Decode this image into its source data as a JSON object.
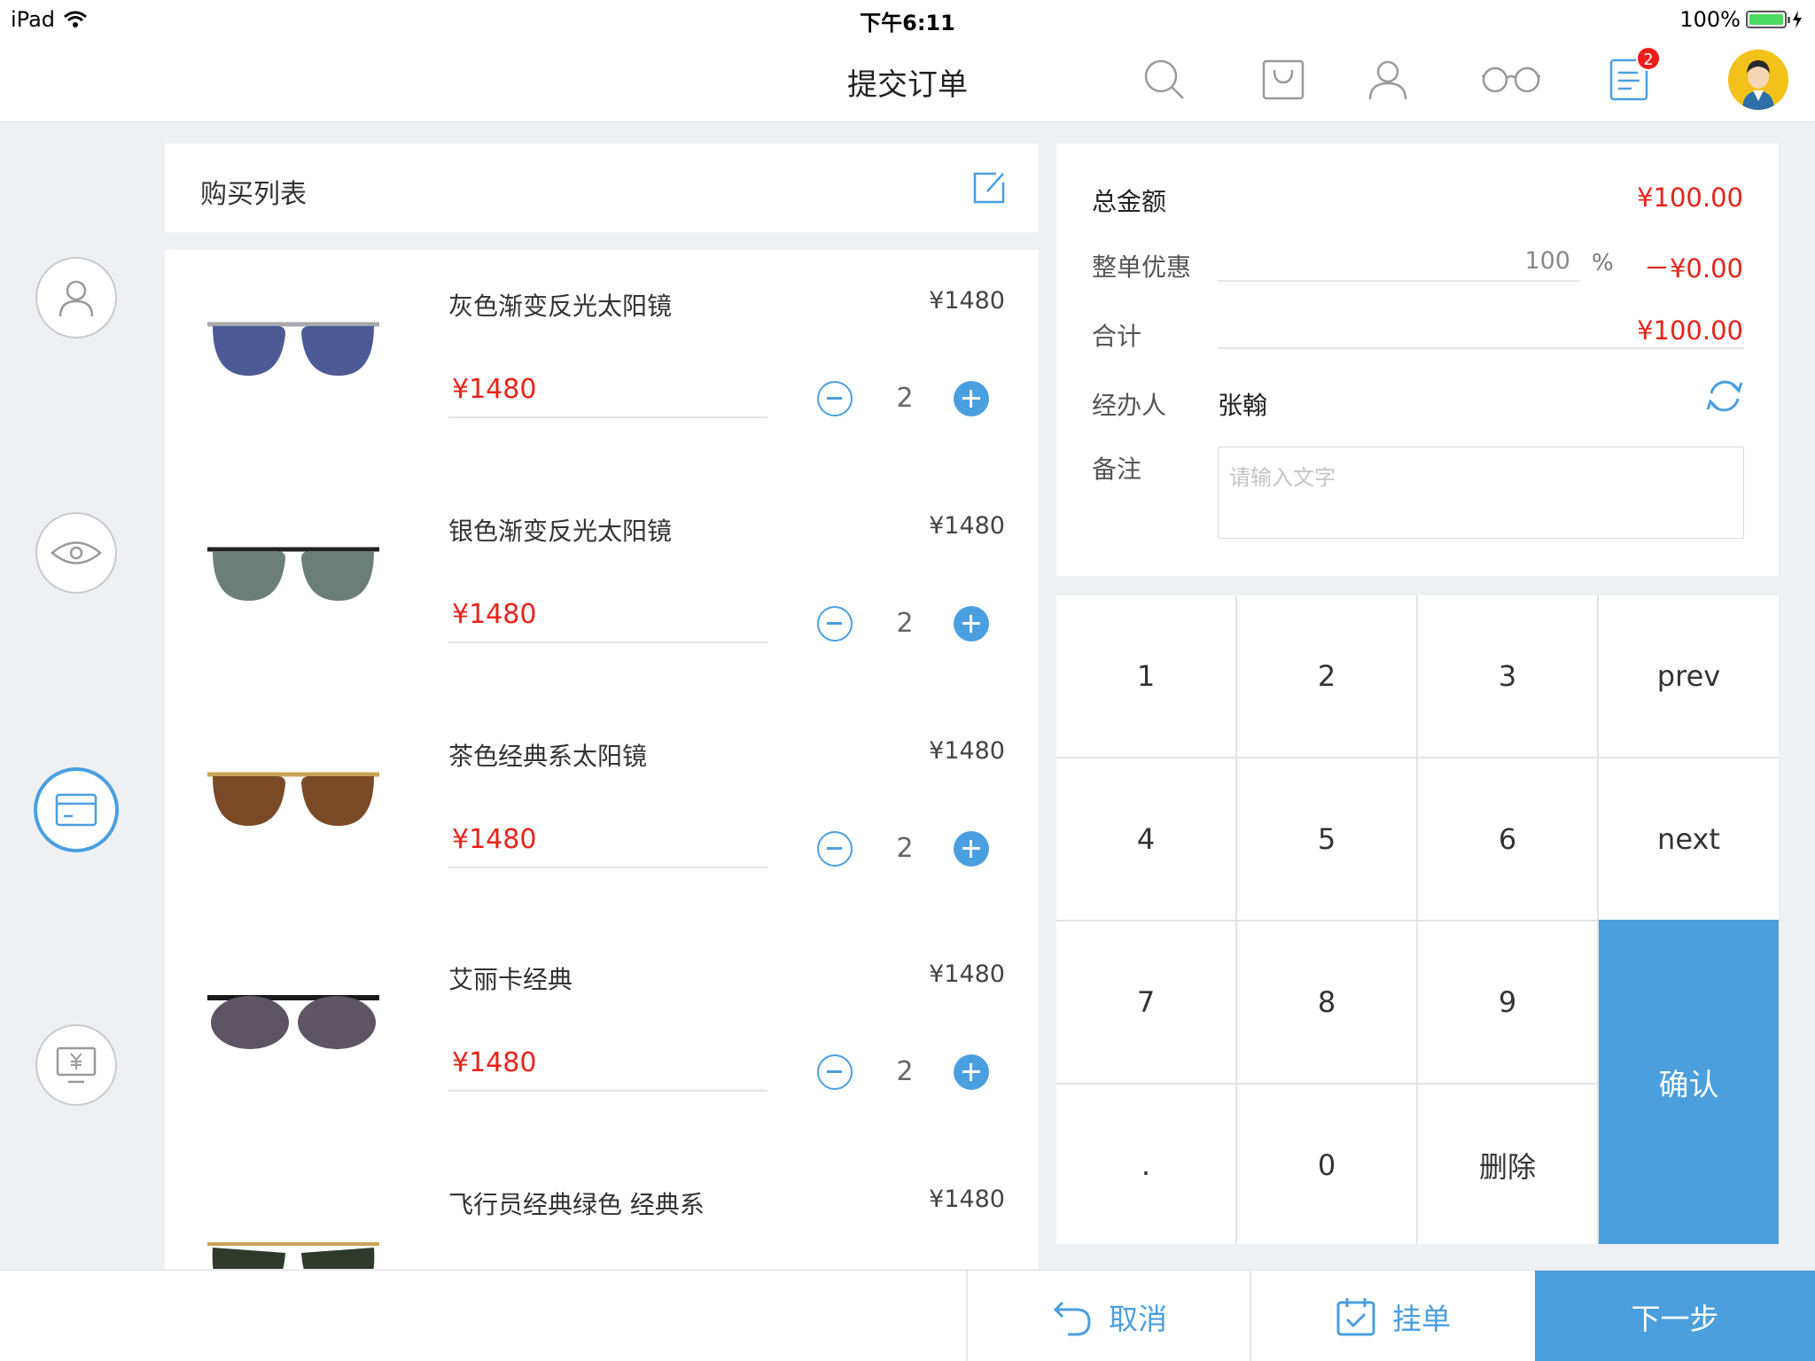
{
  "status_bar": {
    "device": "iPad",
    "time": "下午6:11",
    "battery": "100%"
  },
  "nav": {
    "title": "提交订单",
    "icons": [
      "search-icon",
      "shopping-bag-icon",
      "user-icon",
      "glasses-icon",
      "order-list-icon"
    ],
    "order_badge": "2"
  },
  "rail": [
    "customer-icon",
    "eye-exam-icon",
    "card-icon",
    "payment-icon"
  ],
  "purchase_list": {
    "title": "购买列表",
    "items": [
      {
        "name": "灰色渐变反光太阳镜",
        "list_price": "¥1480",
        "price": "¥1480",
        "qty": "2",
        "lens": "#4c5b96",
        "frame": "#a7a9ad"
      },
      {
        "name": "银色渐变反光太阳镜",
        "list_price": "¥1480",
        "price": "¥1480",
        "qty": "2",
        "lens": "#6b7f78",
        "frame": "#222222"
      },
      {
        "name": "茶色经典系太阳镜",
        "list_price": "¥1480",
        "price": "¥1480",
        "qty": "2",
        "lens": "#7a4a26",
        "frame": "#c9a457"
      },
      {
        "name": "艾丽卡经典",
        "list_price": "¥1480",
        "price": "¥1480",
        "qty": "2",
        "lens": "#5d5564",
        "frame": "#1a1a1a"
      },
      {
        "name": "飞行员经典绿色 经典系",
        "list_price": "¥1480",
        "price": "",
        "qty": "",
        "lens": "#2f3a2c",
        "frame": "#c9a457"
      }
    ]
  },
  "summary": {
    "total_label": "总金额",
    "total_value": "¥100.00",
    "discount_label": "整单优惠",
    "discount_percent": "100",
    "percent_sign": "%",
    "discount_value": "－¥0.00",
    "subtotal_label": "合计",
    "subtotal_value": "¥100.00",
    "handler_label": "经办人",
    "handler_name": "张翰",
    "note_label": "备注",
    "note_placeholder": "请输入文字"
  },
  "keypad": {
    "keys": [
      "1",
      "2",
      "3",
      "prev",
      "4",
      "5",
      "6",
      "next",
      "7",
      "8",
      "9",
      ".",
      "0",
      "删除"
    ],
    "confirm": "确认"
  },
  "bottom": {
    "cancel": "取消",
    "hold": "挂单",
    "next": "下一步"
  },
  "colors": {
    "accent": "#4a9fdc",
    "price_red": "#e8231a",
    "background": "#eff0f4"
  }
}
